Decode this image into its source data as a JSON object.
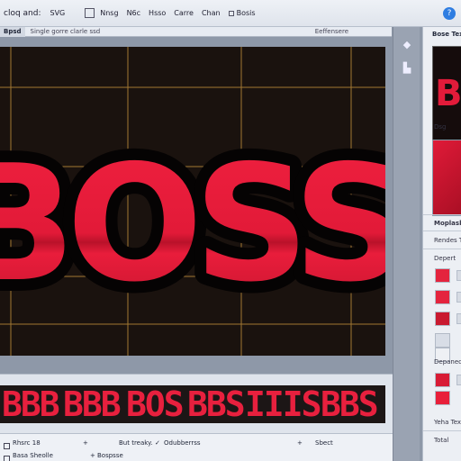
{
  "menubar": {
    "title": "cloq and:",
    "format": "SVG",
    "items": [
      "Nnsg",
      "N6c",
      "Hsso",
      "Carre",
      "Chan",
      "Bosis"
    ],
    "window_button": "?"
  },
  "docbar": {
    "tab_label": "Bpsd",
    "caption": "Single gorre clarle ssd",
    "right_label": "Eeffensere"
  },
  "canvas": {
    "text": "BOSS",
    "colors": {
      "background": "#1a120e",
      "grid": "#b98a3a",
      "text": "#e41b3a",
      "outline": "#050303"
    }
  },
  "tools": {
    "items": [
      "diamond-tool",
      "crop-tool"
    ]
  },
  "right_panel": {
    "title": "Bose Textur",
    "thumbnail_text": "BOS",
    "drag_label": "Dsg",
    "section_moplack": "Moplask",
    "section_rendes": "Rendes Texhure",
    "section_depart": "Depert",
    "section_dependent": "Depanecent",
    "section_texhe": "Yeha Texhe",
    "section_total": "Total",
    "swatches_top": [
      "#e4243e",
      "#e4243e",
      "#c91a30",
      "#d8dde6",
      "#eef0f4"
    ],
    "swatches_bottom": [
      "#d81b35",
      "#e81f3a"
    ]
  },
  "font_strip": {
    "glyph_groups": [
      "BBB",
      "BBB",
      "BOS",
      "BBS",
      "IIIS",
      "BBS"
    ],
    "color": "#e8203e"
  },
  "statusbar": {
    "row1": {
      "name": "Rhsrc 18",
      "mid": "But treaky.",
      "mid2": "Odubberrss",
      "right": "Sbect"
    },
    "row2": {
      "name": "Basa Sheolle",
      "mid": "Bospsse"
    }
  }
}
